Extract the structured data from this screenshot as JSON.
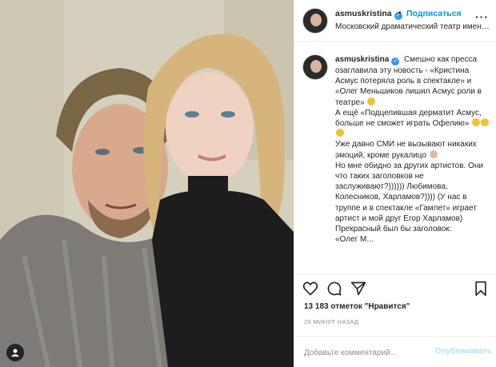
{
  "post": {
    "username": "asmuskristina",
    "follow_label": "Подписаться",
    "separator": "•",
    "location": "Московский драматический театр имени М...",
    "caption_lines": [
      "Смешно как пресса озаглавила эту новость - «Кристина Асмус потеряла роль в спектакле» и «Олег Меньшиков лишил Асмус роли в театре»",
      "А ещё «Подцепившая дерматит Асмус, больше не сможет играть Офелию»",
      "Уже давно СМИ не вызывают никаких эмоций, кроме рукалицо",
      "Но мне обидно за других артистов. Они что таких заголовков не заслуживают?)))))) Любимова, Колесников, Харламов?)))) (У нас в труппе и в спектакле «Гамлет» играет артист и мой друг Егор Харламов)",
      "Прекрасный был бы заголовок:",
      "«Олег М..."
    ],
    "likes_text": "13 183 отметок \"Нравится\"",
    "time_text": "20 МИНУТ НАЗАД",
    "comment_placeholder": "Добавьте комментарий...",
    "publish_label": "Опубликовать"
  },
  "icons": {
    "verified": "verified-badge-icon",
    "more": "more-options-icon",
    "like": "heart-icon",
    "comment": "comment-icon",
    "share": "send-icon",
    "save": "bookmark-icon"
  },
  "colors": {
    "accent": "#0095f6",
    "verified": "#3897f0",
    "muted": "#8e8e8e",
    "publish_disabled": "#b2dffc"
  }
}
